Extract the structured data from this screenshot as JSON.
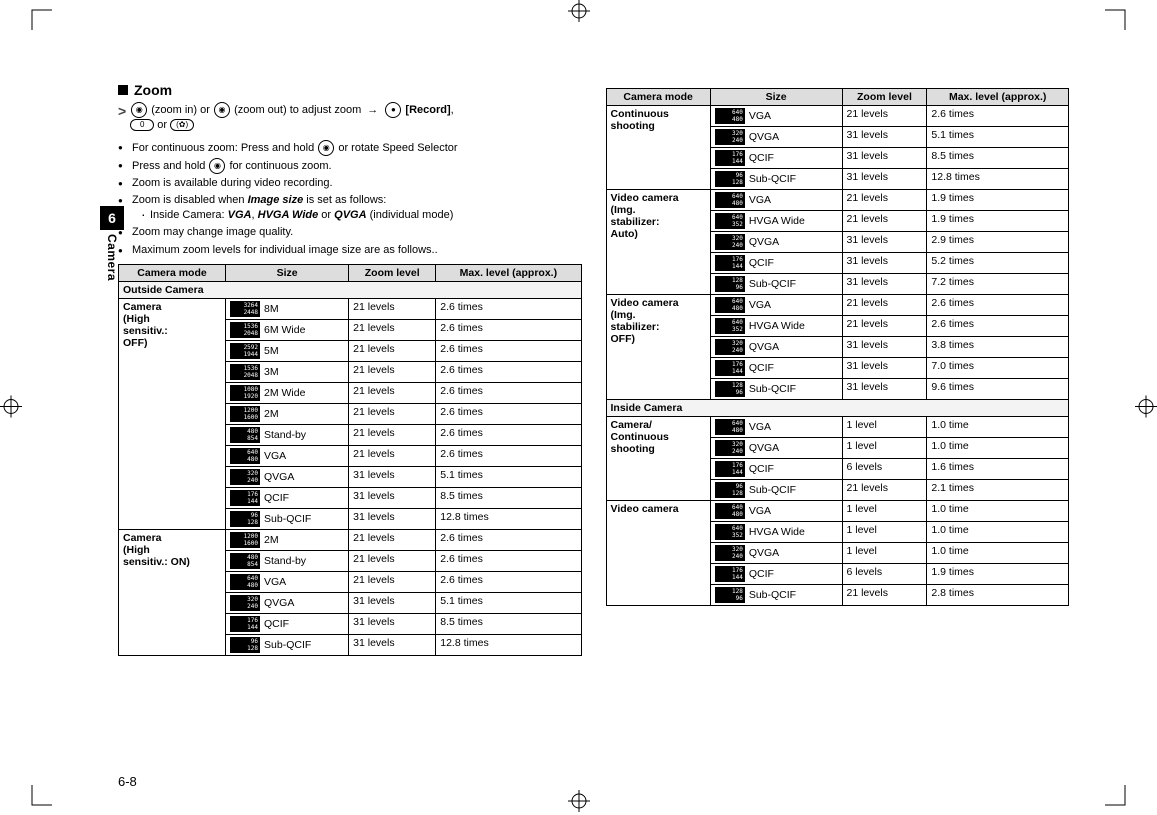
{
  "sideTab": {
    "chapter": "6",
    "label": "Camera"
  },
  "heading": "Zoom",
  "step": {
    "zoomIn": "(zoom in) or",
    "zoomOut": "(zoom out) to adjust zoom",
    "record": "[Record]",
    "orWord": "or",
    "pill1": "0",
    "pill2": "✿"
  },
  "bullets": {
    "b1a": "For continuous zoom: Press and hold ",
    "b1b": " or rotate Speed Selector",
    "b2a": "Press and hold ",
    "b2b": " for continuous zoom.",
    "b3": "Zoom is available during video recording.",
    "b4a": "Zoom is disabled when ",
    "b4b": "Image size",
    "b4c": " is set as follows:",
    "b4sub_a": "Inside Camera: ",
    "b4sub_vga": "VGA",
    "b4sub_comma": ", ",
    "b4sub_hvga": "HVGA Wide",
    "b4sub_or": " or ",
    "b4sub_qvga": "QVGA",
    "b4sub_tail": " (individual mode)",
    "b5": "Zoom may change image quality.",
    "b6": "Maximum zoom levels for individual image size are as follows.."
  },
  "headers": {
    "mode": "Camera mode",
    "size": "Size",
    "zoom": "Zoom level",
    "max": "Max. level (approx.)"
  },
  "subheads": {
    "outside": "Outside Camera",
    "inside": "Inside Camera"
  },
  "leftTable": {
    "groups": [
      {
        "mode": "Camera\n(High\nsensitiv.:\nOFF)",
        "rows": [
          {
            "chip": "3264\n2448",
            "size": "8M",
            "zoom": "21 levels",
            "max": "2.6 times"
          },
          {
            "chip": "1536\n2048",
            "size": "6M Wide",
            "zoom": "21 levels",
            "max": "2.6 times"
          },
          {
            "chip": "2592\n1944",
            "size": "5M",
            "zoom": "21 levels",
            "max": "2.6 times"
          },
          {
            "chip": "1536\n2048",
            "size": "3M",
            "zoom": "21 levels",
            "max": "2.6 times"
          },
          {
            "chip": "1080\n1920",
            "size": "2M Wide",
            "zoom": "21 levels",
            "max": "2.6 times"
          },
          {
            "chip": "1200\n1600",
            "size": "2M",
            "zoom": "21 levels",
            "max": "2.6 times"
          },
          {
            "chip": "480\n854",
            "size": "Stand-by",
            "zoom": "21 levels",
            "max": "2.6 times"
          },
          {
            "chip": "640\n480",
            "size": "VGA",
            "zoom": "21 levels",
            "max": "2.6 times"
          },
          {
            "chip": "320\n240",
            "size": "QVGA",
            "zoom": "31 levels",
            "max": "5.1 times"
          },
          {
            "chip": "176\n144",
            "size": "QCIF",
            "zoom": "31 levels",
            "max": "8.5 times"
          },
          {
            "chip": "96\n128",
            "size": "Sub-QCIF",
            "zoom": "31 levels",
            "max": "12.8 times"
          }
        ]
      },
      {
        "mode": "Camera\n(High\nsensitiv.: ON)",
        "rows": [
          {
            "chip": "1200\n1600",
            "size": "2M",
            "zoom": "21 levels",
            "max": "2.6 times"
          },
          {
            "chip": "480\n854",
            "size": "Stand-by",
            "zoom": "21 levels",
            "max": "2.6 times"
          },
          {
            "chip": "640\n480",
            "size": "VGA",
            "zoom": "21 levels",
            "max": "2.6 times"
          },
          {
            "chip": "320\n240",
            "size": "QVGA",
            "zoom": "31 levels",
            "max": "5.1 times"
          },
          {
            "chip": "176\n144",
            "size": "QCIF",
            "zoom": "31 levels",
            "max": "8.5 times"
          },
          {
            "chip": "96\n128",
            "size": "Sub-QCIF",
            "zoom": "31 levels",
            "max": "12.8 times"
          }
        ]
      }
    ]
  },
  "rightTable": {
    "outsideGroups": [
      {
        "mode": "Continuous\nshooting",
        "rows": [
          {
            "chip": "640\n480",
            "size": "VGA",
            "zoom": "21 levels",
            "max": "2.6 times"
          },
          {
            "chip": "320\n240",
            "size": "QVGA",
            "zoom": "31 levels",
            "max": "5.1 times"
          },
          {
            "chip": "176\n144",
            "size": "QCIF",
            "zoom": "31 levels",
            "max": "8.5 times"
          },
          {
            "chip": "96\n128",
            "size": "Sub-QCIF",
            "zoom": "31 levels",
            "max": "12.8 times"
          }
        ]
      },
      {
        "mode": "Video camera\n(Img.\nstabilizer:\nAuto)",
        "rows": [
          {
            "chip": "640\n480",
            "size": "VGA",
            "zoom": "21 levels",
            "max": "1.9 times"
          },
          {
            "chip": "640\n352",
            "size": "HVGA Wide",
            "zoom": "21 levels",
            "max": "1.9 times"
          },
          {
            "chip": "320\n240",
            "size": "QVGA",
            "zoom": "31 levels",
            "max": "2.9 times"
          },
          {
            "chip": "176\n144",
            "size": "QCIF",
            "zoom": "31 levels",
            "max": "5.2 times"
          },
          {
            "chip": "128\n96",
            "size": "Sub-QCIF",
            "zoom": "31 levels",
            "max": "7.2 times"
          }
        ]
      },
      {
        "mode": "Video camera\n(Img.\nstabilizer:\nOFF)",
        "rows": [
          {
            "chip": "640\n480",
            "size": "VGA",
            "zoom": "21 levels",
            "max": "2.6 times"
          },
          {
            "chip": "640\n352",
            "size": "HVGA Wide",
            "zoom": "21 levels",
            "max": "2.6 times"
          },
          {
            "chip": "320\n240",
            "size": "QVGA",
            "zoom": "31 levels",
            "max": "3.8 times"
          },
          {
            "chip": "176\n144",
            "size": "QCIF",
            "zoom": "31 levels",
            "max": "7.0 times"
          },
          {
            "chip": "128\n96",
            "size": "Sub-QCIF",
            "zoom": "31 levels",
            "max": "9.6 times"
          }
        ]
      }
    ],
    "insideGroups": [
      {
        "mode": "Camera/\nContinuous\nshooting",
        "rows": [
          {
            "chip": "640\n480",
            "size": "VGA",
            "zoom": "1 level",
            "max": "1.0 time"
          },
          {
            "chip": "320\n240",
            "size": "QVGA",
            "zoom": "1 level",
            "max": "1.0 time"
          },
          {
            "chip": "176\n144",
            "size": "QCIF",
            "zoom": "6 levels",
            "max": "1.6 times"
          },
          {
            "chip": "96\n128",
            "size": "Sub-QCIF",
            "zoom": "21 levels",
            "max": "2.1 times"
          }
        ]
      },
      {
        "mode": "Video camera",
        "rows": [
          {
            "chip": "640\n480",
            "size": "VGA",
            "zoom": "1 level",
            "max": "1.0 time"
          },
          {
            "chip": "640\n352",
            "size": "HVGA Wide",
            "zoom": "1 level",
            "max": "1.0 time"
          },
          {
            "chip": "320\n240",
            "size": "QVGA",
            "zoom": "1 level",
            "max": "1.0 time"
          },
          {
            "chip": "176\n144",
            "size": "QCIF",
            "zoom": "6 levels",
            "max": "1.9 times"
          },
          {
            "chip": "128\n96",
            "size": "Sub-QCIF",
            "zoom": "21 levels",
            "max": "2.8 times"
          }
        ]
      }
    ]
  },
  "pageNumber": "6-8"
}
